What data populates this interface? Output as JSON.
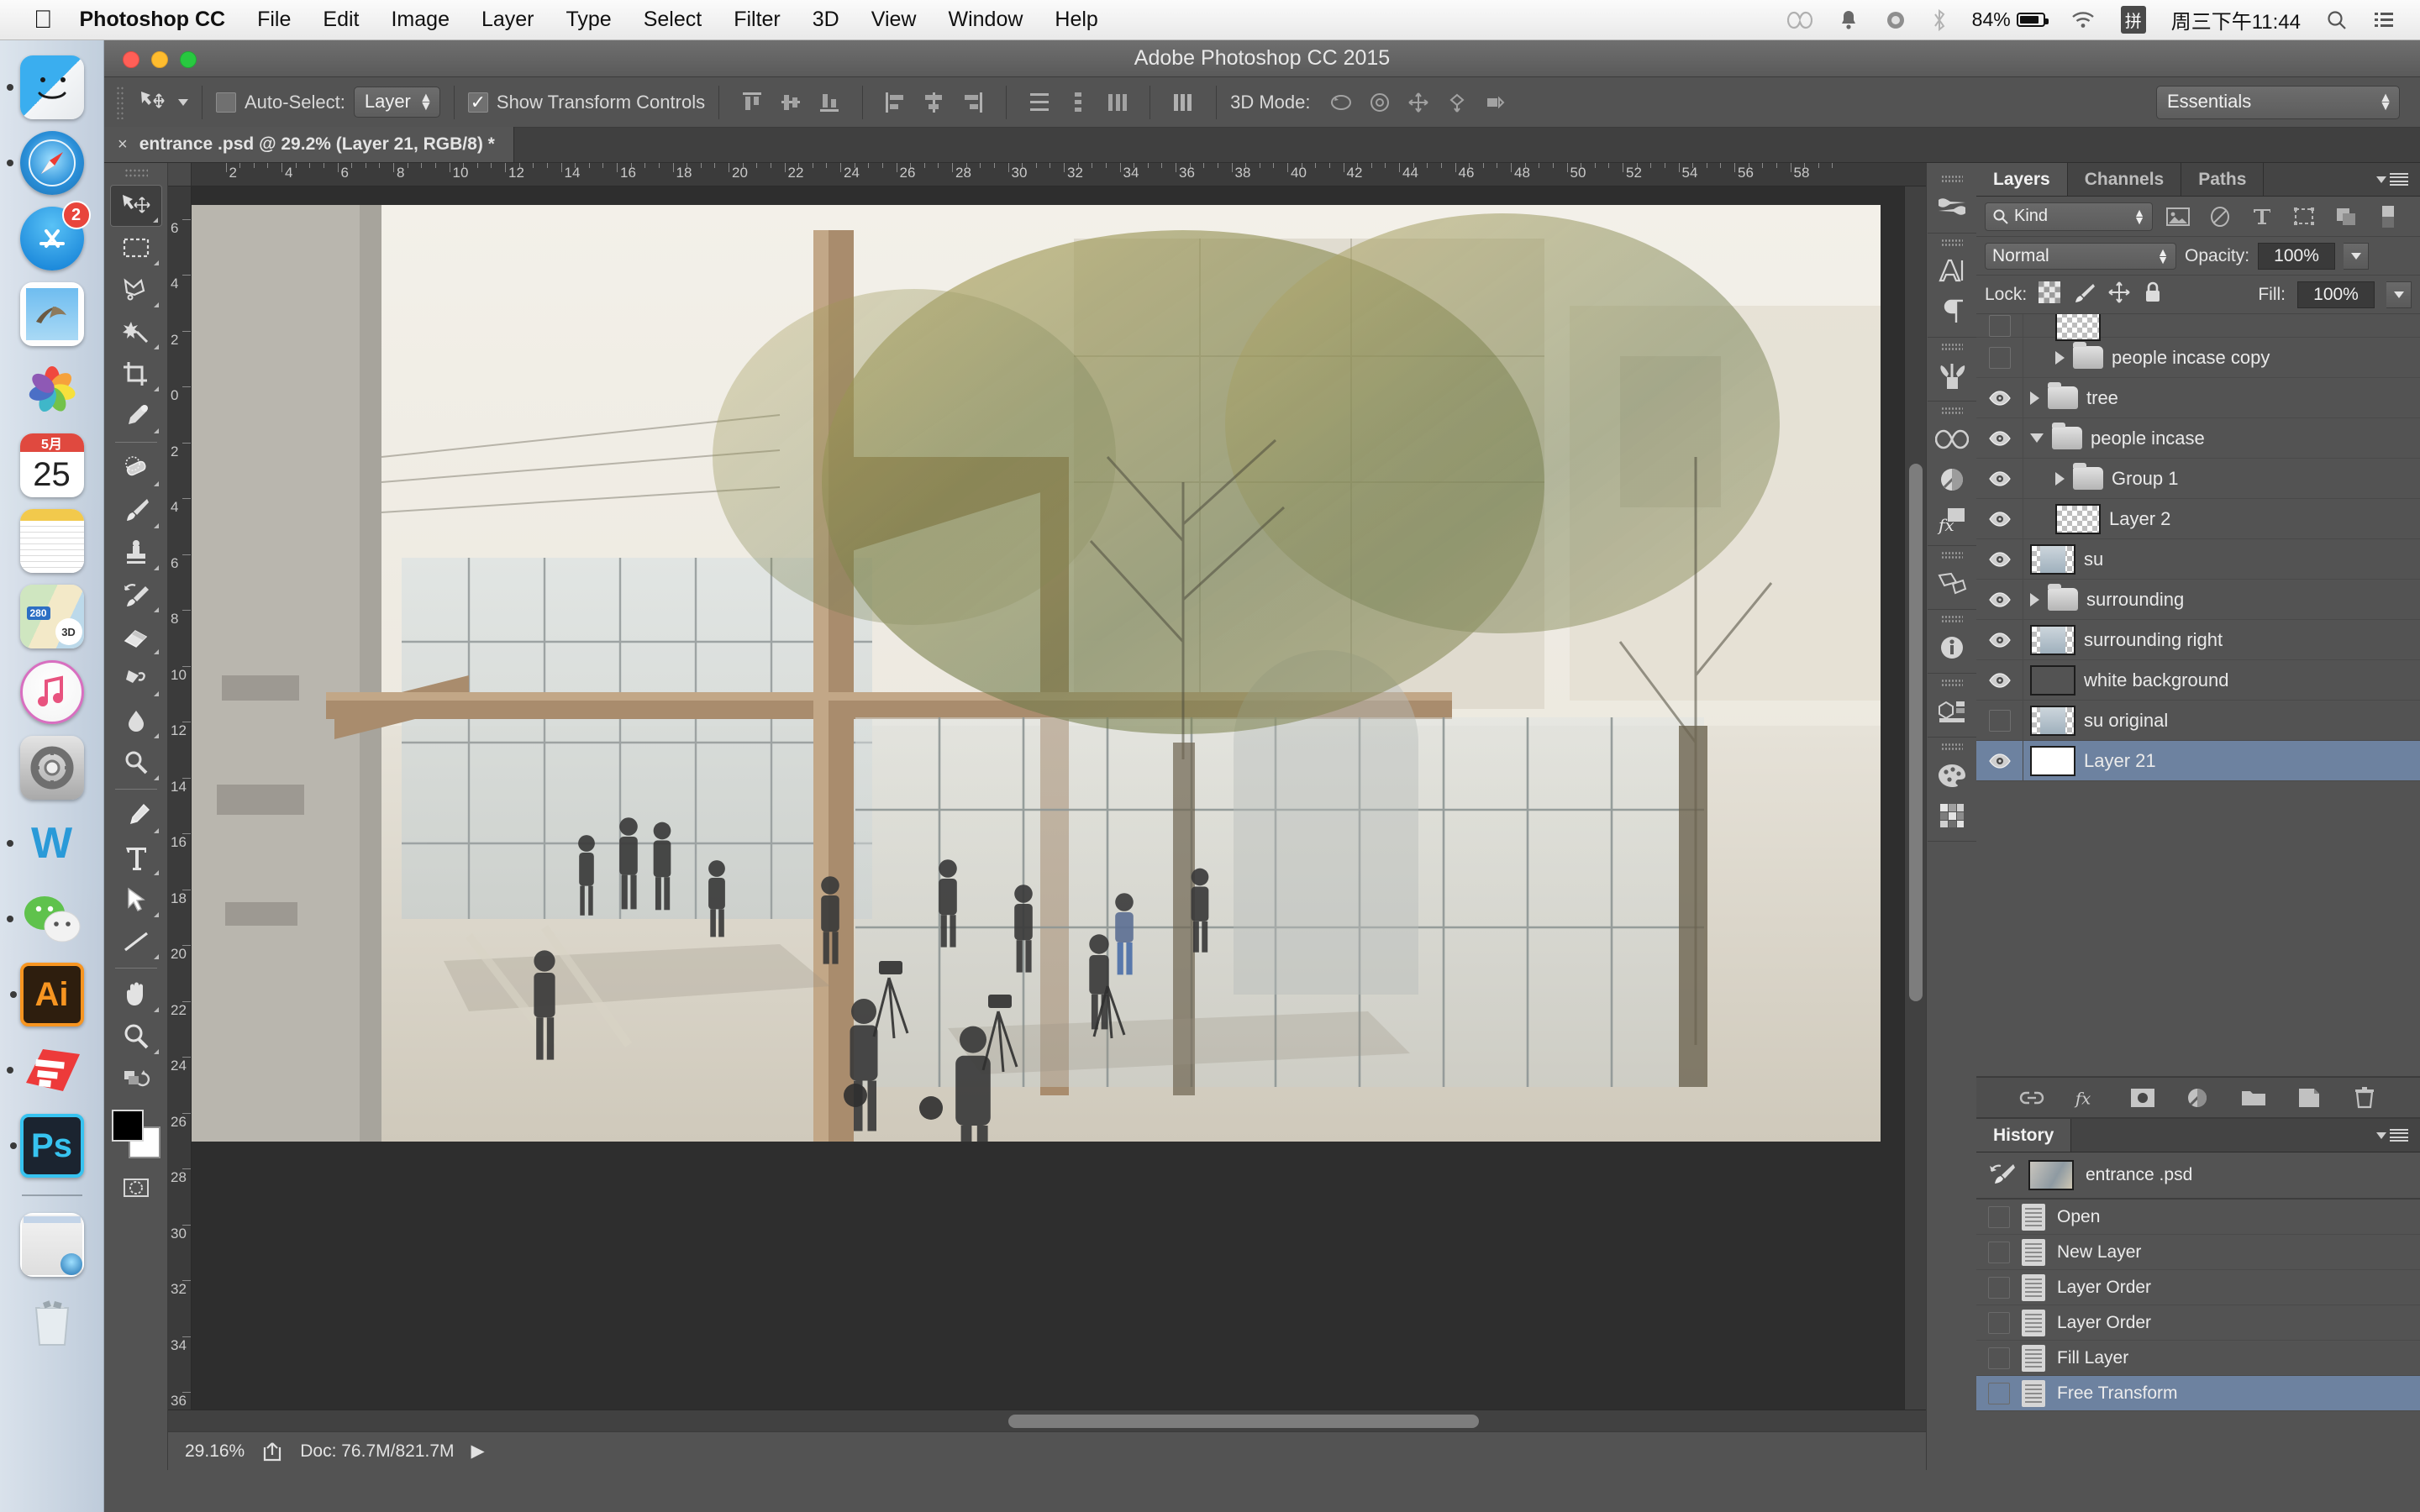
{
  "menubar": {
    "apple": "apple-logo",
    "items": [
      "Photoshop CC",
      "File",
      "Edit",
      "Image",
      "Layer",
      "Type",
      "Select",
      "Filter",
      "3D",
      "View",
      "Window",
      "Help"
    ],
    "status": {
      "battery_percent": "84%",
      "ime": "拼",
      "clock": "周三下午11:44",
      "icons": [
        "creative-cloud-icon",
        "bell-icon",
        "dropbox-icon",
        "bluetooth-icon",
        "battery-icon",
        "wifi-icon",
        "input-method-icon",
        "spotlight-search-icon",
        "notification-center-icon"
      ]
    }
  },
  "dock": {
    "items": [
      {
        "name": "finder",
        "label": "Finder",
        "running": true,
        "badge": ""
      },
      {
        "name": "safari",
        "label": "Safari",
        "running": true,
        "badge": ""
      },
      {
        "name": "app-store",
        "label": "App Store",
        "running": false,
        "badge": "2"
      },
      {
        "name": "mail",
        "label": "Mail",
        "running": false,
        "badge": ""
      },
      {
        "name": "photos",
        "label": "Photos",
        "running": false,
        "badge": ""
      },
      {
        "name": "calendar",
        "label": "Calendar",
        "running": false,
        "badge": "",
        "month": "5月",
        "day": "25"
      },
      {
        "name": "notes",
        "label": "Notes",
        "running": false,
        "badge": ""
      },
      {
        "name": "maps",
        "label": "Maps",
        "running": false,
        "badge": "",
        "road": "280",
        "mode": "3D"
      },
      {
        "name": "itunes",
        "label": "iTunes",
        "running": false,
        "badge": ""
      },
      {
        "name": "system-preferences",
        "label": "System Preferences",
        "running": false,
        "badge": ""
      },
      {
        "name": "word",
        "label": "W",
        "running": true,
        "badge": ""
      },
      {
        "name": "wechat",
        "label": "WeChat",
        "running": true,
        "badge": ""
      },
      {
        "name": "illustrator",
        "label": "Ai",
        "running": true,
        "badge": ""
      },
      {
        "name": "sketchup",
        "label": "SketchUp",
        "running": true,
        "badge": ""
      },
      {
        "name": "photoshop",
        "label": "Ps",
        "running": true,
        "badge": ""
      }
    ],
    "minimized_window": "safari-window-thumbnail",
    "trash": "trash-full"
  },
  "window": {
    "title": "Adobe Photoshop CC 2015"
  },
  "options_bar": {
    "tool": "move-tool",
    "auto_select_label": "Auto-Select:",
    "auto_select_checked": false,
    "auto_select_value": "Layer",
    "show_transform_label": "Show Transform Controls",
    "show_transform_checked": true,
    "three_d_mode_label": "3D Mode:",
    "workspace": "Essentials",
    "align_icons": [
      "align-top-edges",
      "align-vertical-centers",
      "align-bottom-edges",
      "align-left-edges",
      "align-horizontal-centers",
      "align-right-edges",
      "distribute-top-edges",
      "distribute-vertical-centers",
      "distribute-bottom-edges",
      "distribute-left-edges"
    ],
    "three_d_icons": [
      "3d-rotate",
      "3d-roll",
      "3d-pan",
      "3d-slide",
      "3d-scale"
    ]
  },
  "document_tab": {
    "close": "×",
    "title": "entrance .psd @ 29.2% (Layer 21, RGB/8) *"
  },
  "toolbox": {
    "tools": [
      {
        "name": "move-tool",
        "selected": true
      },
      {
        "name": "rectangular-marquee-tool",
        "selected": false
      },
      {
        "name": "lasso-tool",
        "selected": false
      },
      {
        "name": "magic-wand-tool",
        "selected": false
      },
      {
        "name": "crop-tool",
        "selected": false
      },
      {
        "name": "eyedropper-tool",
        "selected": false
      },
      {
        "name": "spot-healing-brush-tool",
        "selected": false
      },
      {
        "name": "brush-tool",
        "selected": false
      },
      {
        "name": "clone-stamp-tool",
        "selected": false
      },
      {
        "name": "history-brush-tool",
        "selected": false
      },
      {
        "name": "eraser-tool",
        "selected": false
      },
      {
        "name": "gradient-tool",
        "selected": false
      },
      {
        "name": "blur-tool",
        "selected": false
      },
      {
        "name": "dodge-tool",
        "selected": false
      },
      {
        "name": "pen-tool",
        "selected": false
      },
      {
        "name": "horizontal-type-tool",
        "selected": false
      },
      {
        "name": "path-selection-tool",
        "selected": false
      },
      {
        "name": "line-tool",
        "selected": false
      },
      {
        "name": "hand-tool",
        "selected": false
      },
      {
        "name": "zoom-tool",
        "selected": false
      }
    ],
    "foreground_color": "#000000",
    "background_color": "#ffffff"
  },
  "rulers": {
    "horizontal": [
      "2",
      "4",
      "6",
      "8",
      "10",
      "12",
      "14",
      "16",
      "18",
      "20",
      "22",
      "24",
      "26",
      "28",
      "30",
      "32",
      "34",
      "36",
      "38",
      "40",
      "42",
      "44",
      "46",
      "48",
      "50",
      "52",
      "54",
      "56",
      "58"
    ],
    "vertical": [
      "6",
      "4",
      "2",
      "0",
      "2",
      "4",
      "6",
      "8",
      "10",
      "12",
      "14",
      "16",
      "18",
      "20",
      "22",
      "24",
      "26",
      "28",
      "30",
      "32",
      "34",
      "36"
    ]
  },
  "status_bar": {
    "zoom": "29.16%",
    "doc": "Doc: 76.7M/821.7M",
    "share_icon": "share-icon",
    "arrow": "▶"
  },
  "icon_dock": [
    {
      "name": "brush-presets-icon"
    },
    {
      "name": "character-panel-icon"
    },
    {
      "name": "paragraph-panel-icon"
    },
    {
      "name": "brush-icon"
    },
    {
      "name": "creative-cloud-libraries-icon"
    },
    {
      "name": "adjustments-icon"
    },
    {
      "name": "styles-icon"
    },
    {
      "name": "3d-panel-icon"
    },
    {
      "name": "info-panel-icon"
    },
    {
      "name": "properties-panel-icon"
    },
    {
      "name": "color-panel-icon"
    },
    {
      "name": "swatches-panel-icon"
    }
  ],
  "layers_panel": {
    "tabs": [
      {
        "label": "Layers",
        "active": true
      },
      {
        "label": "Channels",
        "active": false
      },
      {
        "label": "Paths",
        "active": false
      }
    ],
    "filter": {
      "kind": "Kind",
      "icons": [
        "filter-pixel-icon",
        "filter-adjustment-icon",
        "filter-type-icon",
        "filter-shape-icon",
        "filter-smart-object-icon",
        "filter-toggle"
      ]
    },
    "blend_mode": "Normal",
    "opacity_label": "Opacity:",
    "opacity_value": "100%",
    "lock_label": "Lock:",
    "lock_icons": [
      "lock-transparent-pixels-icon",
      "lock-image-pixels-icon",
      "lock-position-icon",
      "lock-all-icon"
    ],
    "fill_label": "Fill:",
    "fill_value": "100%",
    "layers": [
      {
        "name": "",
        "type": "clipped-partial",
        "visible": false,
        "expanded": false,
        "indent": 1,
        "thumb": "transparent",
        "selected": false,
        "partial": true
      },
      {
        "name": "people incase copy",
        "type": "group",
        "visible": false,
        "expanded": false,
        "indent": 1,
        "thumb": "folder",
        "selected": false
      },
      {
        "name": "tree",
        "type": "group",
        "visible": true,
        "expanded": false,
        "indent": 0,
        "thumb": "folder",
        "selected": false
      },
      {
        "name": "people incase",
        "type": "group",
        "visible": true,
        "expanded": true,
        "indent": 0,
        "thumb": "folder-open",
        "selected": false
      },
      {
        "name": "Group 1",
        "type": "group",
        "visible": true,
        "expanded": false,
        "indent": 1,
        "thumb": "folder",
        "selected": false
      },
      {
        "name": "Layer 2",
        "type": "pixel",
        "visible": true,
        "expanded": false,
        "indent": 1,
        "thumb": "transparent",
        "selected": false
      },
      {
        "name": "su",
        "type": "pixel",
        "visible": true,
        "expanded": false,
        "indent": 0,
        "thumb": "transparent-image",
        "selected": false
      },
      {
        "name": "surrounding",
        "type": "group",
        "visible": true,
        "expanded": false,
        "indent": 0,
        "thumb": "folder",
        "selected": false
      },
      {
        "name": "surrounding right",
        "type": "pixel",
        "visible": true,
        "expanded": false,
        "indent": 0,
        "thumb": "transparent-image",
        "selected": false
      },
      {
        "name": "white background",
        "type": "pixel",
        "visible": true,
        "expanded": false,
        "indent": 0,
        "thumb": "beige-image",
        "selected": false
      },
      {
        "name": "su original",
        "type": "pixel",
        "visible": false,
        "expanded": false,
        "indent": 0,
        "thumb": "transparent-image",
        "selected": false
      },
      {
        "name": "Layer 21",
        "type": "pixel",
        "visible": true,
        "expanded": false,
        "indent": 0,
        "thumb": "white",
        "selected": true
      }
    ],
    "footer_icons": [
      "link-layers-icon",
      "add-layer-style-icon",
      "add-layer-mask-icon",
      "new-adjustment-layer-icon",
      "new-group-icon",
      "new-layer-icon",
      "delete-layer-icon"
    ]
  },
  "history_panel": {
    "tab": "History",
    "snapshot": {
      "name": "entrance .psd",
      "icon": "history-brush-icon"
    },
    "states": [
      {
        "label": "Open",
        "selected": false
      },
      {
        "label": "New Layer",
        "selected": false
      },
      {
        "label": "Layer Order",
        "selected": false
      },
      {
        "label": "Layer Order",
        "selected": false
      },
      {
        "label": "Fill Layer",
        "selected": false
      },
      {
        "label": "Free Transform",
        "selected": true
      }
    ]
  },
  "colors": {
    "selection_blue": "#6d82a0",
    "panel_bg": "#535353",
    "canvas_bg": "#2e2e2e"
  }
}
